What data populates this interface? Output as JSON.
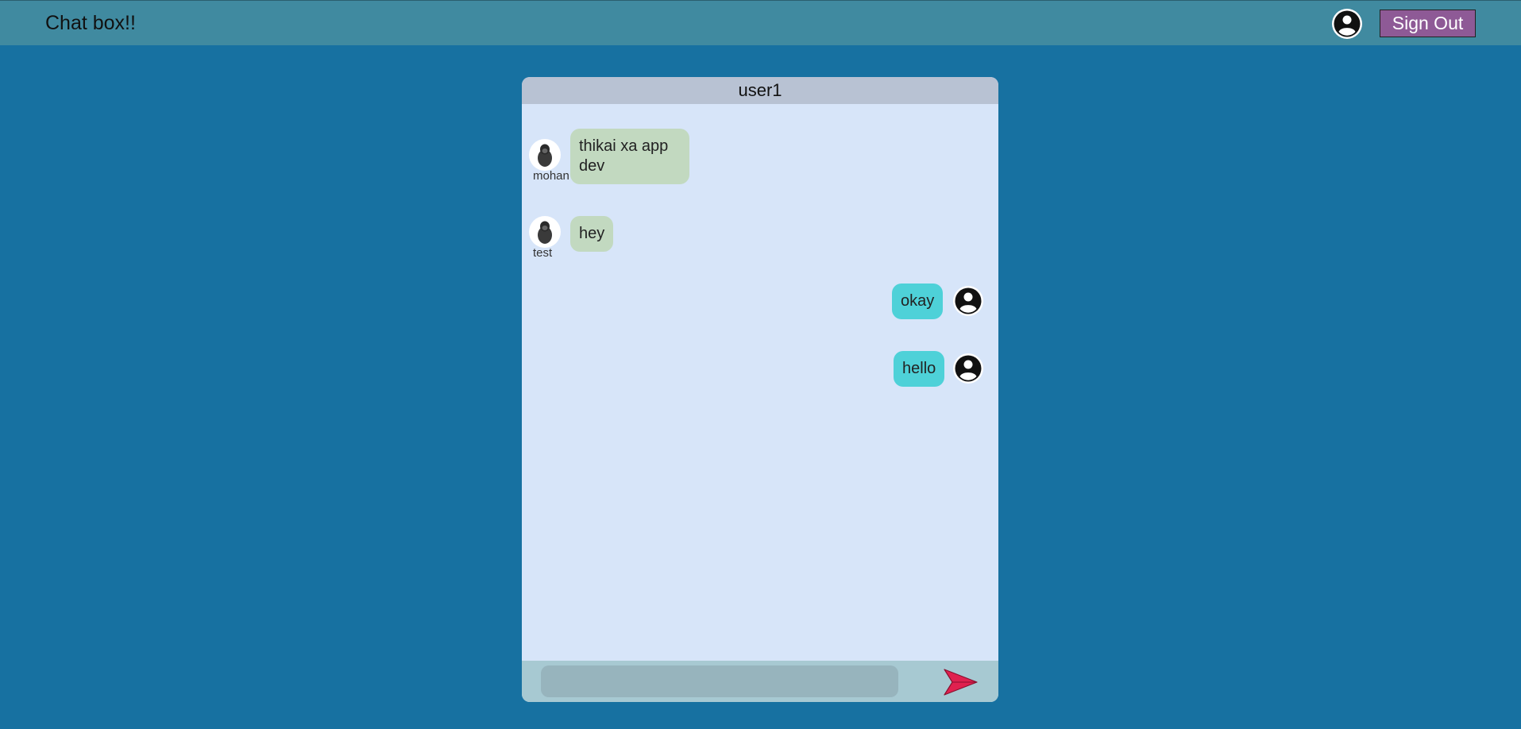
{
  "header": {
    "title": "Chat box!!",
    "sign_out_label": "Sign Out"
  },
  "chat": {
    "title": "user1",
    "messages": [
      {
        "sender": "mohan",
        "text_line1": "thikai xa app",
        "text_line2": "dev",
        "direction": "incoming"
      },
      {
        "sender": "test",
        "text": "hey",
        "direction": "incoming"
      },
      {
        "text": "okay",
        "direction": "outgoing"
      },
      {
        "text": "hello",
        "direction": "outgoing"
      }
    ]
  },
  "composer": {
    "value": "",
    "placeholder": ""
  },
  "icons": {
    "user_avatar": "user-circle-icon",
    "sender_avatar": "hooded-figure-icon",
    "send": "send-arrow-icon"
  },
  "colors": {
    "page_bg": "#1771a1",
    "topbar_bg": "#408aa0",
    "sign_out_bg": "#8e5a96",
    "chat_bg": "#d7e5f9",
    "chat_header_bg": "#b8c2d3",
    "incoming_bubble": "#c2d9c0",
    "outgoing_bubble": "#4ed1d8",
    "composer_bg": "#a7c9d2",
    "send_icon": "#e0214f"
  }
}
